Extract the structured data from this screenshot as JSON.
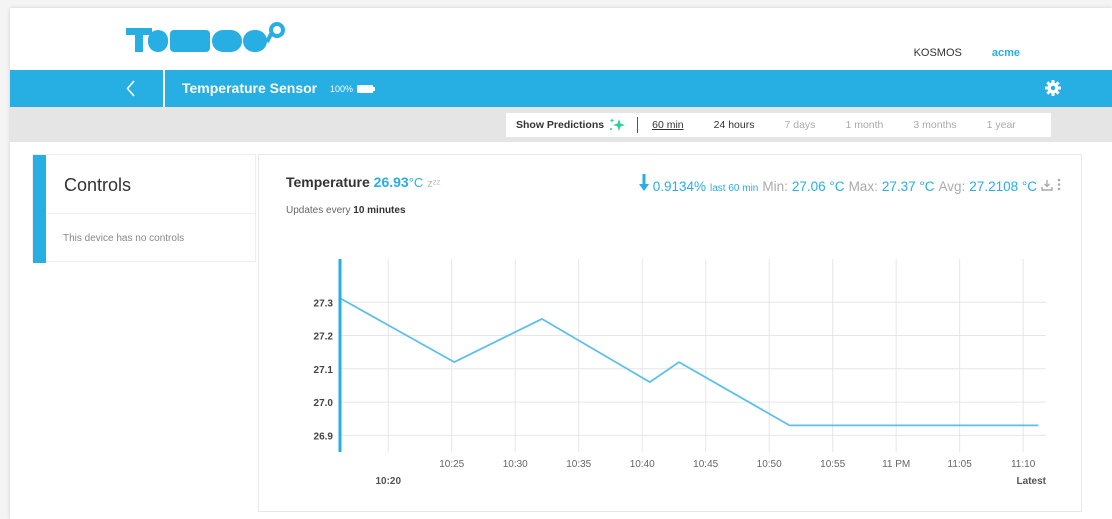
{
  "header": {
    "nav_user": "KOSMOS",
    "nav_account": "acme"
  },
  "toolbar": {
    "title": "Temperature Sensor",
    "battery": "100%"
  },
  "rangebar": {
    "predictions_label": "Show Predictions",
    "ranges": [
      "60 min",
      "24 hours",
      "7 days",
      "1 month",
      "3 months",
      "1 year"
    ],
    "selected": "60 min"
  },
  "controls": {
    "title": "Controls",
    "message": "This device has no controls"
  },
  "card": {
    "label": "Temperature",
    "value": "26.93",
    "unit": "°C",
    "sleep": "zᶻᶻ",
    "updates_prefix": "Updates every",
    "updates_value": "10 minutes",
    "change": "0.9134%",
    "change_period": "last 60 min",
    "min_label": "Min:",
    "min_value": "27.06 °C",
    "max_label": "Max:",
    "max_value": "27.37 °C",
    "avg_label": "Avg:",
    "avg_value": "27.2108 °C"
  },
  "colors": {
    "accent": "#27aee3",
    "line": "#5cc0ea"
  },
  "chart_data": {
    "type": "line",
    "ytick_labels": [
      "27.3",
      "27.2",
      "27.1",
      "27.0",
      "26.9"
    ],
    "yticks": [
      27.3,
      27.2,
      27.1,
      27.0,
      26.9
    ],
    "ylim": [
      26.88,
      27.43
    ],
    "x_domain_min": [
      14,
      60
    ],
    "xticks": [
      {
        "label": "10:20",
        "m": 20,
        "row": 2
      },
      {
        "label": "10:25",
        "m": 25,
        "row": 1
      },
      {
        "label": "10:30",
        "m": 30,
        "row": 1
      },
      {
        "label": "10:35",
        "m": 35,
        "row": 1
      },
      {
        "label": "10:40",
        "m": 40,
        "row": 1
      },
      {
        "label": "10:45",
        "m": 45,
        "row": 1
      },
      {
        "label": "10:50",
        "m": 50,
        "row": 1
      },
      {
        "label": "10:55",
        "m": 55,
        "row": 1
      },
      {
        "label": "11 PM",
        "m": 60,
        "row": 1
      },
      {
        "label": "11:05",
        "m": 65,
        "row": 1
      },
      {
        "label": "11:10",
        "m": 70,
        "row": 1
      },
      {
        "label": "Latest",
        "m": 71.2,
        "row": 2
      }
    ],
    "x_domain": [
      16.2,
      71.8
    ],
    "series": [
      {
        "points": [
          {
            "m": 16.3,
            "y": 27.31
          },
          {
            "m": 25.2,
            "y": 27.12
          },
          {
            "m": 32.1,
            "y": 27.25
          },
          {
            "m": 40.6,
            "y": 27.06
          },
          {
            "m": 42.9,
            "y": 27.12
          },
          {
            "m": 51.6,
            "y": 26.93
          },
          {
            "m": 71.2,
            "y": 26.93
          }
        ]
      }
    ],
    "grid": true
  }
}
